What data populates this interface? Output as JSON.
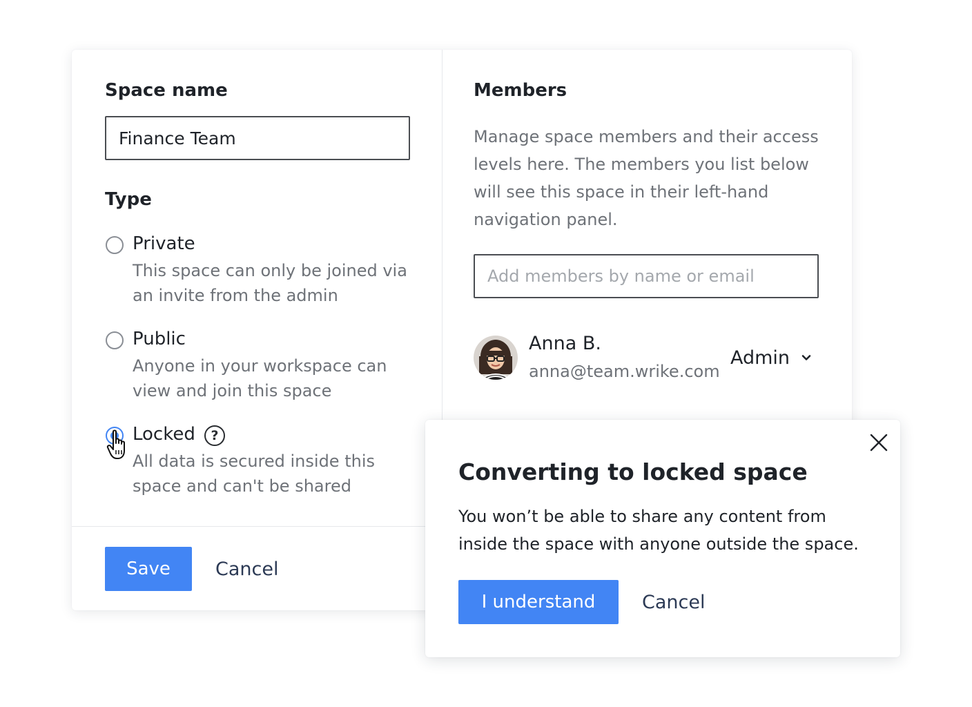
{
  "space_form": {
    "space_name_heading": "Space name",
    "space_name_value": "Finance Team",
    "type_heading": "Type",
    "options": [
      {
        "label": "Private",
        "description": "This space can only be joined via an invite from the admin",
        "selected": false
      },
      {
        "label": "Public",
        "description": "Anyone in your workspace can view and join this space",
        "selected": false
      },
      {
        "label": "Locked",
        "description": "All data is secured inside this space and can't be shared",
        "selected": true,
        "help_icon_text": "?"
      }
    ],
    "save_label": "Save",
    "cancel_label": "Cancel"
  },
  "members": {
    "heading": "Members",
    "description": "Manage space members and their access levels here. The members you list below will see this space in their left-hand navigation panel.",
    "add_placeholder": "Add members by name or email",
    "list": [
      {
        "name": "Anna B.",
        "email": "anna@team.wrike.com",
        "role": "Admin"
      }
    ]
  },
  "dialog": {
    "title": "Converting to locked space",
    "body": "You won’t be able to share any content from inside the space with anyone outside the space.",
    "confirm_label": "I understand",
    "cancel_label": "Cancel"
  },
  "colors": {
    "accent": "#4285f4",
    "text_primary": "#1f2329",
    "text_secondary": "#6e7278",
    "link_text": "#2c3a55"
  },
  "icons": [
    "help-icon",
    "pointer-cursor-icon",
    "chevron-down-icon",
    "close-icon",
    "avatar"
  ]
}
